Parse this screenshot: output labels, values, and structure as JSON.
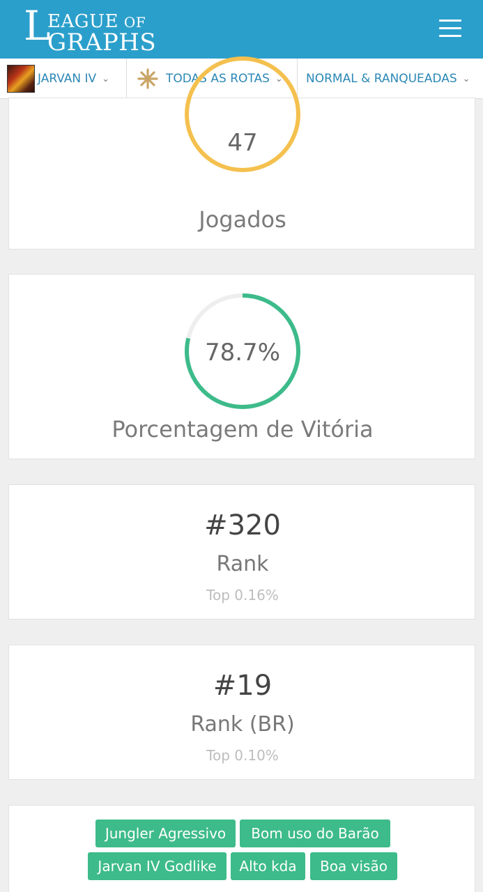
{
  "header": {
    "logo": {
      "l": "L",
      "line1": "EAGUE",
      "of": "OF",
      "line2": "GRAPHS"
    }
  },
  "filters": {
    "champion": "JARVAN IV",
    "role": "TODAS AS ROTAS",
    "queue": "NORMAL & RANQUEADAS"
  },
  "stats": {
    "played": {
      "value": "47",
      "label": "Jogados"
    },
    "winrate": {
      "value": "78.7%",
      "label": "Porcentagem de Vitória",
      "fraction": 0.787
    },
    "rank": {
      "value": "#320",
      "label": "Rank",
      "sub": "Top 0.16%"
    },
    "rank_br": {
      "value": "#19",
      "label": "Rank (BR)",
      "sub": "Top 0.10%"
    }
  },
  "tags": [
    "Jungler Agressivo",
    "Bom uso do Barão",
    "Jarvan IV Godlike",
    "Alto kda",
    "Boa visão"
  ],
  "colors": {
    "header": "#2b9fcb",
    "played_ring": "#f4c04e",
    "win_ring": "#3dbb8a",
    "ring_track": "#eeeeee",
    "tag": "#3dbb8a"
  },
  "icons": {
    "menu": "hamburger-icon",
    "role": "all-roles-star-icon",
    "chevron": "chevron-down-icon"
  }
}
